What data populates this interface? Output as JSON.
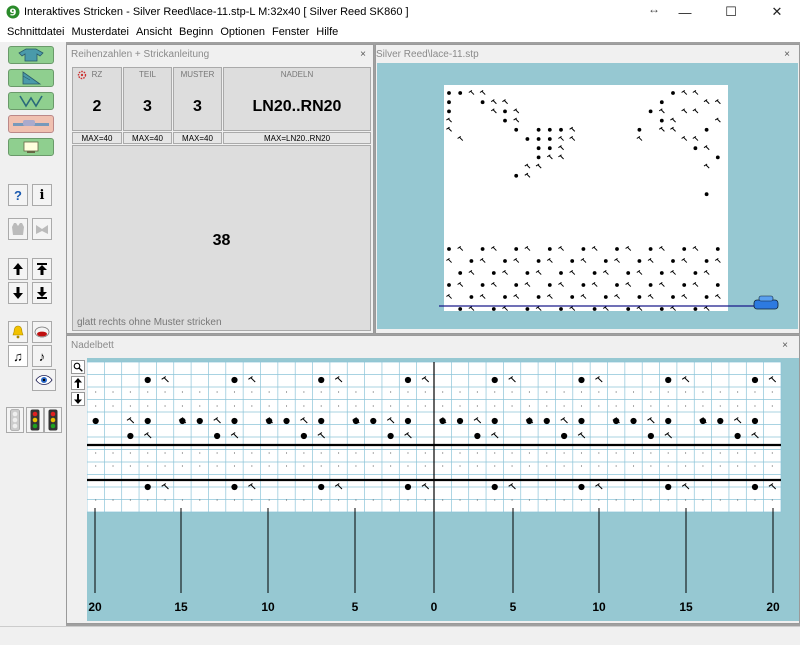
{
  "window": {
    "title": "Interaktives Stricken - Silver Reed\\lace-11.stp-L    M:32x40    [ Silver Reed SK860 ]",
    "minimize": "—",
    "maximize": "☐",
    "close": "✕",
    "icon": "app-logo-icon"
  },
  "menu": [
    "Schnittdatei",
    "Musterdatei",
    "Ansicht",
    "Beginn",
    "Optionen",
    "Fenster",
    "Hilfe"
  ],
  "instructions": {
    "title": "Reihenzahlen + Strickanleitung",
    "close": "×",
    "columns": [
      {
        "head": "RZ",
        "value": "2",
        "max": "MAX=40"
      },
      {
        "head": "TEIL",
        "value": "3",
        "max": "MAX=40"
      },
      {
        "head": "MUSTER",
        "value": "3",
        "max": "MAX=40"
      },
      {
        "head": "NADELN",
        "value": "LN20..RN20",
        "max": "MAX=LN20..RN20"
      }
    ],
    "big_number": "38",
    "note": "glatt rechts ohne Muster stricken"
  },
  "preview": {
    "title": "Silver Reed\\lace-11.stp",
    "close": "×"
  },
  "needlebed": {
    "title": "Nadelbett",
    "close": "×",
    "scale_labels": [
      "20",
      "15",
      "10",
      "5",
      "0",
      "5",
      "10",
      "15",
      "20"
    ]
  },
  "colors": {
    "teal": "#96c8d2",
    "button_green": "#8fcf8f"
  }
}
